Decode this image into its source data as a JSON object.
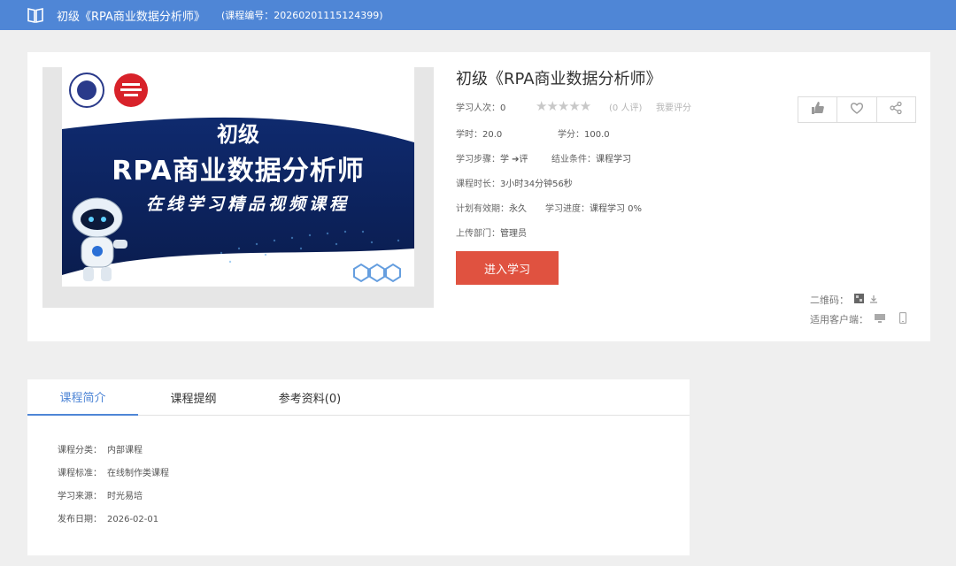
{
  "header": {
    "title": "初级《RPA商业数据分析师》",
    "code": "(课程编号：20260201115124399)"
  },
  "course": {
    "cover_line1": "初级",
    "cover_line2": "RPA商业数据分析师",
    "cover_line3": "在线学习精品视频课程",
    "title": "初级《RPA商业数据分析师》",
    "learners_label": "学习人次：",
    "learners_value": "0",
    "rating_stars": "★★★★★",
    "rating_count": "(0 人评)",
    "rate_link": "我要评分",
    "hours_label": "学时：",
    "hours_value": "20.0",
    "credit_label": "学分：",
    "credit_value": "100.0",
    "steps_label": "学习步骤：",
    "steps_value": "学 ➔评",
    "complete_label": "结业条件：",
    "complete_value": "课程学习",
    "duration_label": "课程时长：",
    "duration_value": "3小时34分钟56秒",
    "validity_label": "计划有效期：",
    "validity_value": "永久",
    "progress_label": "学习进度：",
    "progress_value": "课程学习   0%",
    "dept_label": "上传部门：",
    "dept_value": "管理员",
    "enter_button": "进入学习",
    "qr_label": "二维码：",
    "client_label": "适用客户端："
  },
  "actions": {
    "icons": [
      "thumbs-up-icon",
      "heart-icon",
      "share-icon"
    ]
  },
  "tabs": [
    {
      "label": "课程简介",
      "active": true
    },
    {
      "label": "课程提纲",
      "active": false
    },
    {
      "label": "参考资料(0)",
      "active": false
    }
  ],
  "details": [
    {
      "label": "课程分类：",
      "value": "内部课程"
    },
    {
      "label": "课程标准：",
      "value": "在线制作类课程"
    },
    {
      "label": "学习来源：",
      "value": "时光易培"
    },
    {
      "label": "发布日期：",
      "value": "2026-02-01"
    }
  ],
  "colors": {
    "header_bg": "#4f86d6",
    "accent": "#4f86d6",
    "enter_button": "#e05240"
  }
}
